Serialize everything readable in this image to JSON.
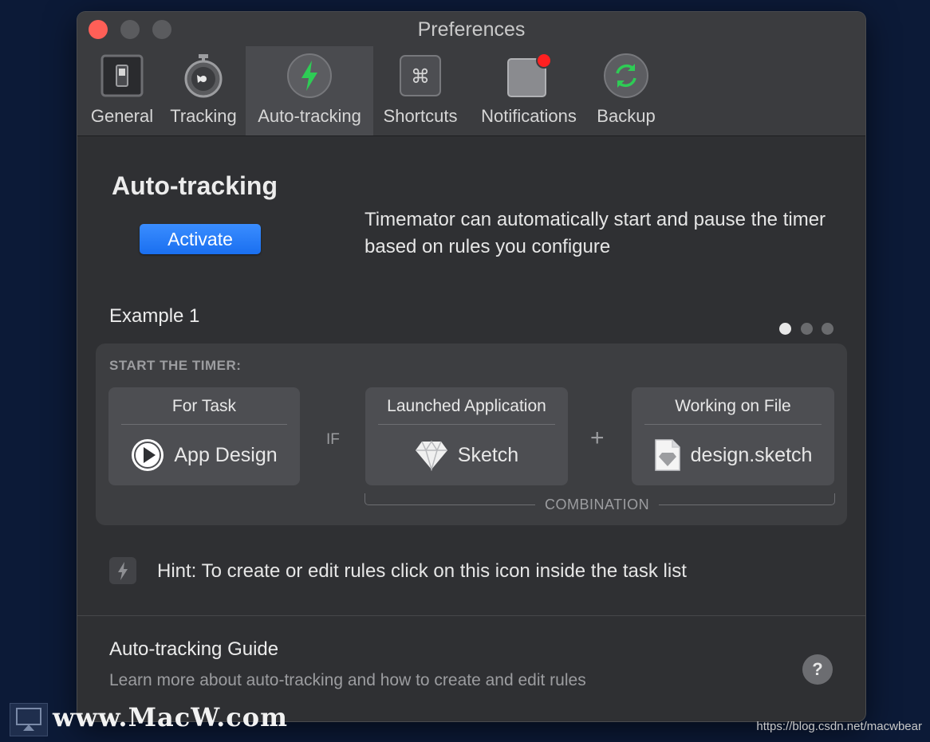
{
  "window": {
    "title": "Preferences"
  },
  "toolbar": {
    "items": [
      {
        "label": "General",
        "icon": "switch-icon"
      },
      {
        "label": "Tracking",
        "icon": "stopwatch-icon"
      },
      {
        "label": "Auto-tracking",
        "icon": "lightning-icon",
        "active": true
      },
      {
        "label": "Shortcuts",
        "icon": "command-icon"
      },
      {
        "label": "Notifications",
        "icon": "notification-badge-icon"
      },
      {
        "label": "Backup",
        "icon": "sync-icon"
      }
    ]
  },
  "main": {
    "heading": "Auto-tracking",
    "activate_label": "Activate",
    "description": "Timemator can automatically start and pause the timer based on rules you configure",
    "example": {
      "title": "Example 1",
      "page_count": 3,
      "current_page": 1,
      "start_label": "START THE TIMER:",
      "task_card": {
        "header": "For Task",
        "value": "App Design"
      },
      "if_label": "IF",
      "app_card": {
        "header": "Launched Application",
        "value": "Sketch"
      },
      "plus_label": "+",
      "file_card": {
        "header": "Working on File",
        "value": "design.sketch"
      },
      "combination_label": "COMBINATION"
    },
    "hint": "Hint: To create or edit rules click on this icon inside the task list",
    "guide": {
      "title": "Auto-tracking Guide",
      "subtitle": "Learn more about auto-tracking and how to create and edit rules",
      "help_label": "?"
    }
  },
  "watermark": {
    "site": "www.MacW.com",
    "url": "https://blog.csdn.net/macwbear"
  },
  "colors": {
    "accent": "#1a6ff0",
    "close": "#fe5f57",
    "badge": "#ff2020",
    "green": "#2ecc55"
  }
}
